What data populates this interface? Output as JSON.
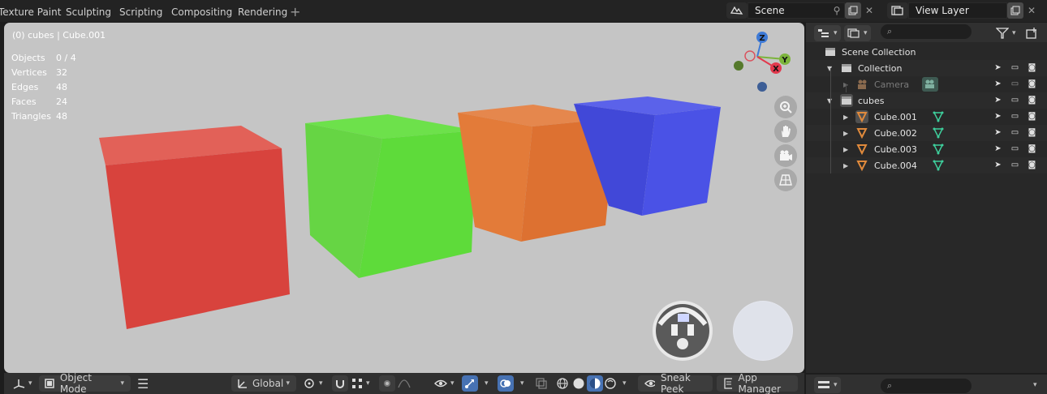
{
  "workspace_tabs": [
    "Texture Paint",
    "Sculpting",
    "Scripting",
    "Compositing",
    "Rendering"
  ],
  "add_workspace": "+",
  "scene": {
    "name": "Scene"
  },
  "view_layer": {
    "name": "View Layer"
  },
  "viewport": {
    "title": "(0) cubes | Cube.001",
    "stats": [
      {
        "label": "Objects",
        "value": "0 / 4"
      },
      {
        "label": "Vertices",
        "value": "32"
      },
      {
        "label": "Edges",
        "value": "48"
      },
      {
        "label": "Faces",
        "value": "24"
      },
      {
        "label": "Triangles",
        "value": "48"
      }
    ],
    "gizmo_axes": [
      "Z",
      "Y",
      "X"
    ],
    "cube_colors": [
      "#d8433d",
      "#5edb3a",
      "#dd7131",
      "#4a52e6"
    ]
  },
  "header": {
    "mode": "Object Mode",
    "orientation": "Global",
    "sneak_peek": "Sneak Peek",
    "app_manager": "App Manager"
  },
  "outliner": {
    "search_placeholder": "",
    "scene_collection": "Scene Collection",
    "rows": [
      {
        "label": "Collection"
      },
      {
        "label": "Camera"
      },
      {
        "label": "cubes"
      },
      {
        "label": "Cube.001"
      },
      {
        "label": "Cube.002"
      },
      {
        "label": "Cube.003"
      },
      {
        "label": "Cube.004"
      }
    ]
  },
  "colors": {
    "accent": "#4772b3",
    "mesh_icon": "#e08a3c",
    "modifier_icon": "#3ecf9c",
    "viewport_bg": "#c5c5c5"
  }
}
